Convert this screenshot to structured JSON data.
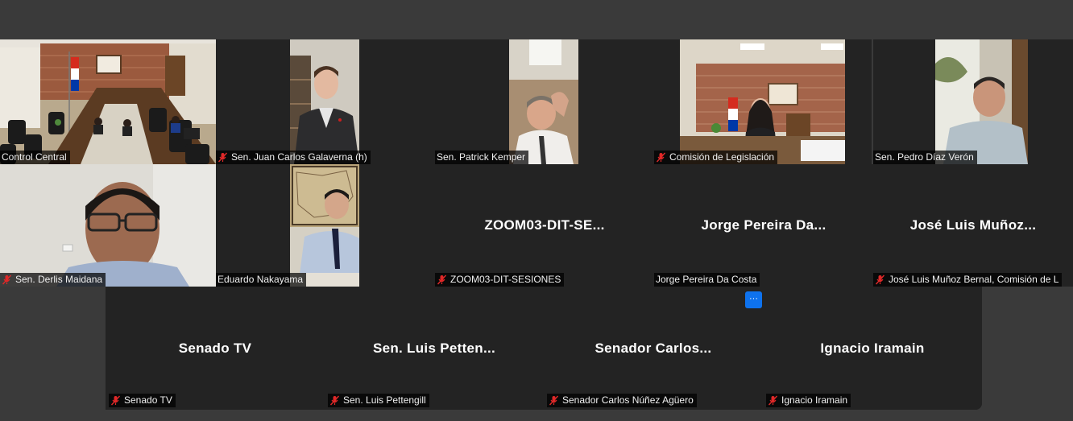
{
  "window": {
    "more_label": "···"
  },
  "colors": {
    "active_speaker": "#23d96e",
    "tile_bg": "#232323",
    "page_bg": "#3a3a3a",
    "mic_muted": "#e02828",
    "accent": "#0e72ed"
  },
  "participants": [
    {
      "tag": "Control Central",
      "muted": false,
      "video": true,
      "active": true
    },
    {
      "tag": "Sen. Juan Carlos Galaverna (h)",
      "muted": true,
      "video": true
    },
    {
      "tag": "Sen. Patrick Kemper",
      "muted": false,
      "video": true
    },
    {
      "tag": "Comisión de Legislación",
      "muted": true,
      "video": true
    },
    {
      "tag": "Sen. Pedro Díaz Verón",
      "muted": false,
      "video": true
    },
    {
      "tag": "Sen. Derlis Maidana",
      "muted": true,
      "video": true
    },
    {
      "tag": "Eduardo Nakayama",
      "muted": false,
      "video": true
    },
    {
      "display": "ZOOM03-DIT-SE...",
      "tag": "ZOOM03-DIT-SESIONES",
      "muted": true,
      "video": false
    },
    {
      "display": "Jorge Pereira Da...",
      "tag": "Jorge Pereira Da Costa",
      "muted": false,
      "video": false
    },
    {
      "display": "José Luis Muñoz...",
      "tag": "José Luis Muñoz Bernal, Comisión de L",
      "muted": true,
      "video": false
    },
    {
      "display": "Senado TV",
      "tag": "Senado TV",
      "muted": true,
      "video": false
    },
    {
      "display": "Sen. Luis Petten...",
      "tag": "Sen. Luis Pettengill",
      "muted": true,
      "video": false
    },
    {
      "display": "Senador Carlos...",
      "tag": "Senador Carlos Núñez Agüero",
      "muted": true,
      "video": false
    },
    {
      "display": "Ignacio Iramain",
      "tag": "Ignacio Iramain",
      "muted": true,
      "video": false
    }
  ]
}
